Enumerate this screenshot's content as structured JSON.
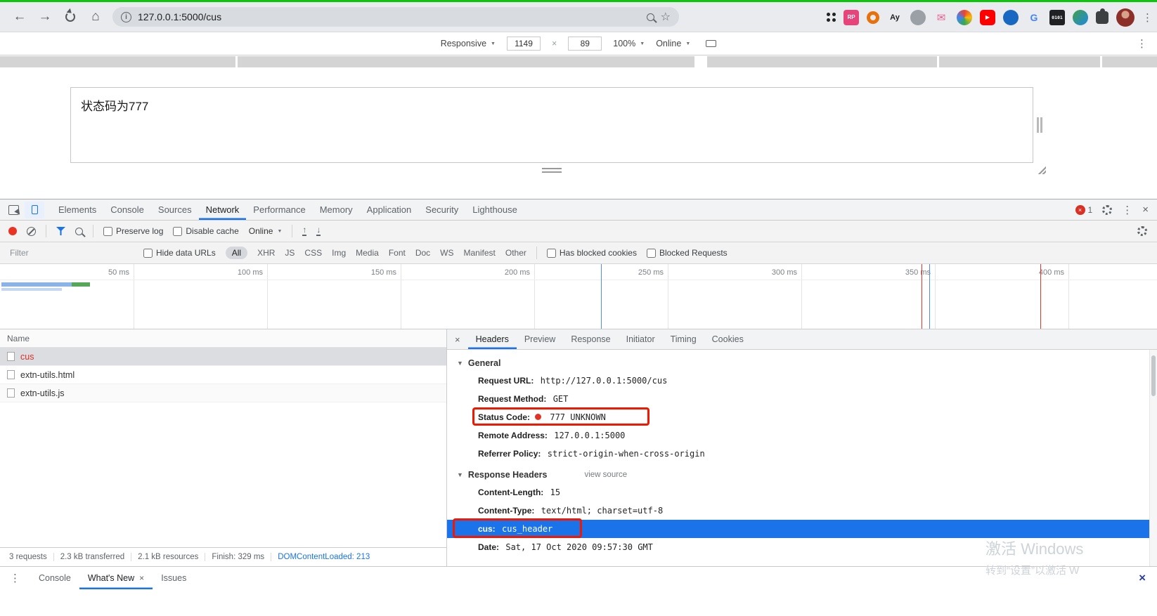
{
  "glyphs": {
    "back": "←",
    "forward": "→",
    "home": "⌂",
    "info": "i",
    "star": "☆",
    "menu": "⋮",
    "caret": "▼",
    "close": "×",
    "up_arrow": "↑",
    "down_arrow": "↓"
  },
  "browser": {
    "url": "127.0.0.1:5000/cus",
    "extensions": {
      "rp": "RP",
      "ay": "Ay",
      "g": "G",
      "binary": "0101",
      "mail": "✉",
      "play": "▶"
    }
  },
  "device_toolbar": {
    "mode": "Responsive",
    "width_value": "1149",
    "times": "×",
    "height_value": "89",
    "zoom": "100%",
    "network": "Online"
  },
  "page": {
    "textarea_text": "状态码为777"
  },
  "devtools": {
    "tabs": [
      "Elements",
      "Console",
      "Sources",
      "Network",
      "Performance",
      "Memory",
      "Application",
      "Security",
      "Lighthouse"
    ],
    "error_count": "1",
    "toolbar": {
      "preserve_log": "Preserve log",
      "disable_cache": "Disable cache",
      "throttling": "Online"
    },
    "filter": {
      "placeholder": "Filter",
      "hide_data_urls": "Hide data URLs",
      "types": [
        "All",
        "XHR",
        "JS",
        "CSS",
        "Img",
        "Media",
        "Font",
        "Doc",
        "WS",
        "Manifest",
        "Other"
      ],
      "blocked_cookies": "Has blocked cookies",
      "blocked_requests": "Blocked Requests"
    },
    "timeline": {
      "labels": [
        "50 ms",
        "100 ms",
        "150 ms",
        "200 ms",
        "250 ms",
        "300 ms",
        "350 ms",
        "400 ms"
      ]
    },
    "requests": {
      "header": "Name",
      "rows": [
        {
          "name": "cus"
        },
        {
          "name": "extn-utils.html"
        },
        {
          "name": "extn-utils.js"
        }
      ]
    },
    "details": {
      "tabs": [
        "Headers",
        "Preview",
        "Response",
        "Initiator",
        "Timing",
        "Cookies"
      ],
      "general": {
        "title": "General",
        "items": [
          {
            "k": "Request URL:",
            "v": "http://127.0.0.1:5000/cus"
          },
          {
            "k": "Request Method:",
            "v": "GET"
          },
          {
            "k": "Status Code:",
            "v": "777 UNKNOWN"
          },
          {
            "k": "Remote Address:",
            "v": "127.0.0.1:5000"
          },
          {
            "k": "Referrer Policy:",
            "v": "strict-origin-when-cross-origin"
          }
        ]
      },
      "response": {
        "title": "Response Headers",
        "view_source": "view source",
        "items": [
          {
            "k": "Content-Length:",
            "v": "15"
          },
          {
            "k": "Content-Type:",
            "v": "text/html; charset=utf-8"
          },
          {
            "k": "cus:",
            "v": "cus_header"
          },
          {
            "k": "Date:",
            "v": "Sat, 17 Oct 2020 09:57:30 GMT"
          }
        ]
      }
    },
    "statusbar": {
      "items": [
        "3 requests",
        "2.3 kB transferred",
        "2.1 kB resources",
        "Finish: 329 ms",
        "DOMContentLoaded: 213"
      ]
    },
    "drawer": {
      "tabs": [
        "Console",
        "What's New",
        "Issues"
      ]
    }
  },
  "watermark": {
    "line1": "激活 Windows",
    "line2": "转到“设置”以激活 W"
  }
}
